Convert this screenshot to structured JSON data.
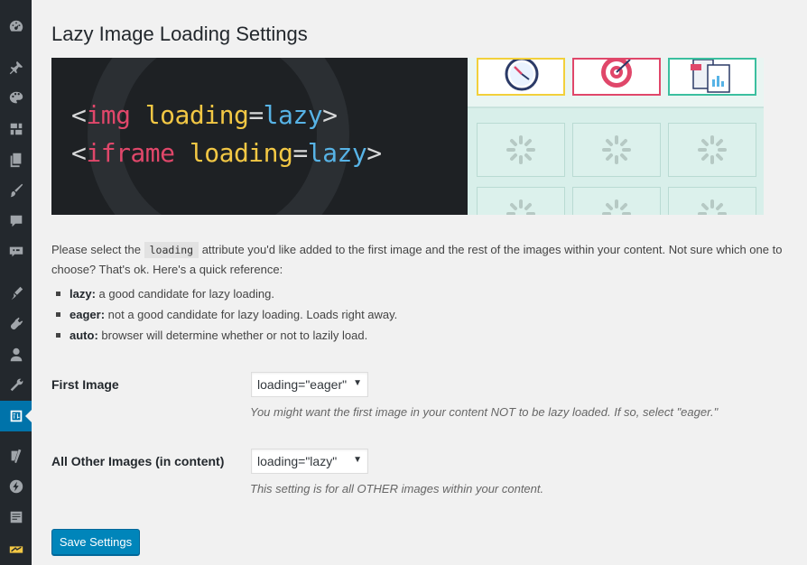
{
  "sidebar": {
    "icons": [
      "dashboard-icon",
      "pin-icon",
      "palette-icon",
      "media-icon",
      "pages-icon",
      "brush-icon",
      "comments-icon",
      "feedback-icon",
      "appearance-icon",
      "plugins-icon",
      "users-icon",
      "tools-icon",
      "settings-icon",
      "yoast-icon",
      "bolt-icon",
      "forms-icon",
      "extra-icon"
    ]
  },
  "page": {
    "title": "Lazy Image Loading Settings"
  },
  "banner": {
    "line1": {
      "open": "<",
      "tag": "img",
      "attr": "loading",
      "eq": "=",
      "val": "lazy",
      "close": ">"
    },
    "line2": {
      "open": "<",
      "tag": "iframe",
      "attr": "loading",
      "eq": "=",
      "val": "lazy",
      "close": ">"
    }
  },
  "description": {
    "before": "Please select the ",
    "code": "loading",
    "after": " attribute you'd like added to the first image and the rest of the images within your content. Not sure which one to choose? That's ok. Here's a quick reference:"
  },
  "reference": [
    {
      "term": "lazy:",
      "text": " a good candidate for lazy loading."
    },
    {
      "term": "eager:",
      "text": " not a good candidate for lazy loading. Loads right away."
    },
    {
      "term": "auto:",
      "text": " browser will determine whether or not to lazily load."
    }
  ],
  "first_image": {
    "label": "First Image",
    "value": "loading=\"eager\"",
    "hint": "You might want the first image in your content NOT to be lazy loaded. If so, select \"eager.\""
  },
  "other_images": {
    "label": "All Other Images (in content)",
    "value": "loading=\"lazy\"",
    "hint": "This setting is for all OTHER images within your content."
  },
  "save_label": "Save Settings",
  "colors": {
    "accent": "#0073aa",
    "button": "#0085ba",
    "sidebar": "#23282d"
  }
}
